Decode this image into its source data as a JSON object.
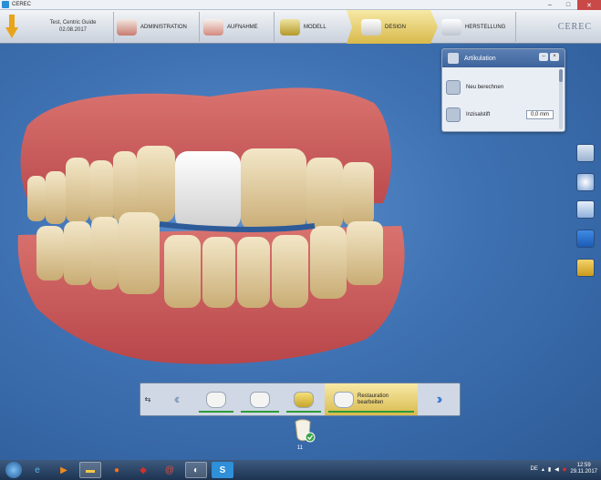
{
  "window": {
    "title": "CEREC"
  },
  "header": {
    "patient_name": "Test, Centric Guide",
    "patient_date": "02.08.2017",
    "steps": [
      {
        "label": "ADMINISTRATION",
        "icon": "tooth-model-icon"
      },
      {
        "label": "AUFNAHME",
        "icon": "scan-icon"
      },
      {
        "label": "MODELL",
        "icon": "model-icon"
      },
      {
        "label": "DESIGN",
        "icon": "design-icon",
        "active": true
      },
      {
        "label": "HERSTELLUNG",
        "icon": "milling-icon"
      }
    ],
    "logo": "CEREC"
  },
  "panel": {
    "title": "Artikulation",
    "rows": [
      {
        "label": "Neu berechnen",
        "icon": "recalculate-icon"
      },
      {
        "label": "Inzisalstift",
        "icon": "incisal-pin-icon",
        "value": "0,0 mm"
      }
    ]
  },
  "workflow": {
    "steps": [
      {
        "icon": "restoration-tooth-icon",
        "done": true
      },
      {
        "icon": "tooth-position-icon",
        "done": true
      },
      {
        "icon": "gold-tooth-icon",
        "done": true
      },
      {
        "label": "Restauration bearbeiten",
        "icon": "edit-restoration-icon",
        "active": true
      }
    ]
  },
  "tooth_indicator": {
    "number": "11"
  },
  "taskbar": {
    "lang": "DE",
    "time": "12:59",
    "date": "29.11.2017"
  },
  "colors": {
    "background": "#3f72b3",
    "active_step": "#e8cf6f",
    "progress_green": "#2d9a3a"
  }
}
